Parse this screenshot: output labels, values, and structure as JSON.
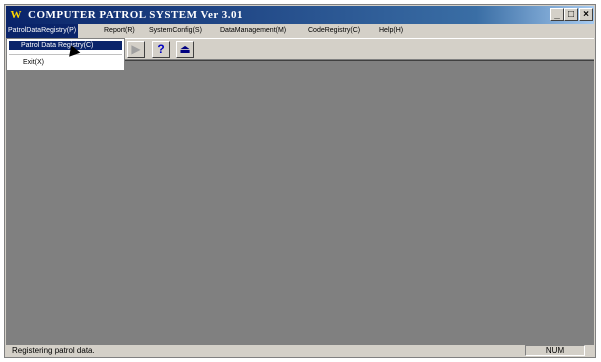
{
  "window": {
    "title": "COMPUTER PATROL SYSTEM  Ver 3.01",
    "controls": {
      "minimize": "_",
      "maximize": "□",
      "close": "×"
    }
  },
  "menubar": {
    "items": [
      {
        "label": "PatrolDataRegistry(P)"
      },
      {
        "label": "Report(R)"
      },
      {
        "label": "SystemConfig(S)"
      },
      {
        "label": "DataManagement(M)"
      },
      {
        "label": "CodeRegistry(C)"
      },
      {
        "label": "Help(H)"
      }
    ]
  },
  "dropdown": {
    "items": [
      {
        "label": "Patrol Data Registry(C)"
      },
      {
        "label": "Exit(X)"
      }
    ]
  },
  "toolbar": {
    "buttons": [
      {
        "icon": "play-icon",
        "glyph": "▶"
      },
      {
        "icon": "help-icon",
        "glyph": "?"
      },
      {
        "icon": "exit-icon",
        "glyph": "⏏"
      }
    ]
  },
  "statusbar": {
    "message": "Registering patrol data.",
    "indicator": "NUM"
  },
  "colors": {
    "titlebar": "#0a246a",
    "workspace": "#808080",
    "chrome": "#d4d0c8",
    "selection": "#0a246a"
  }
}
